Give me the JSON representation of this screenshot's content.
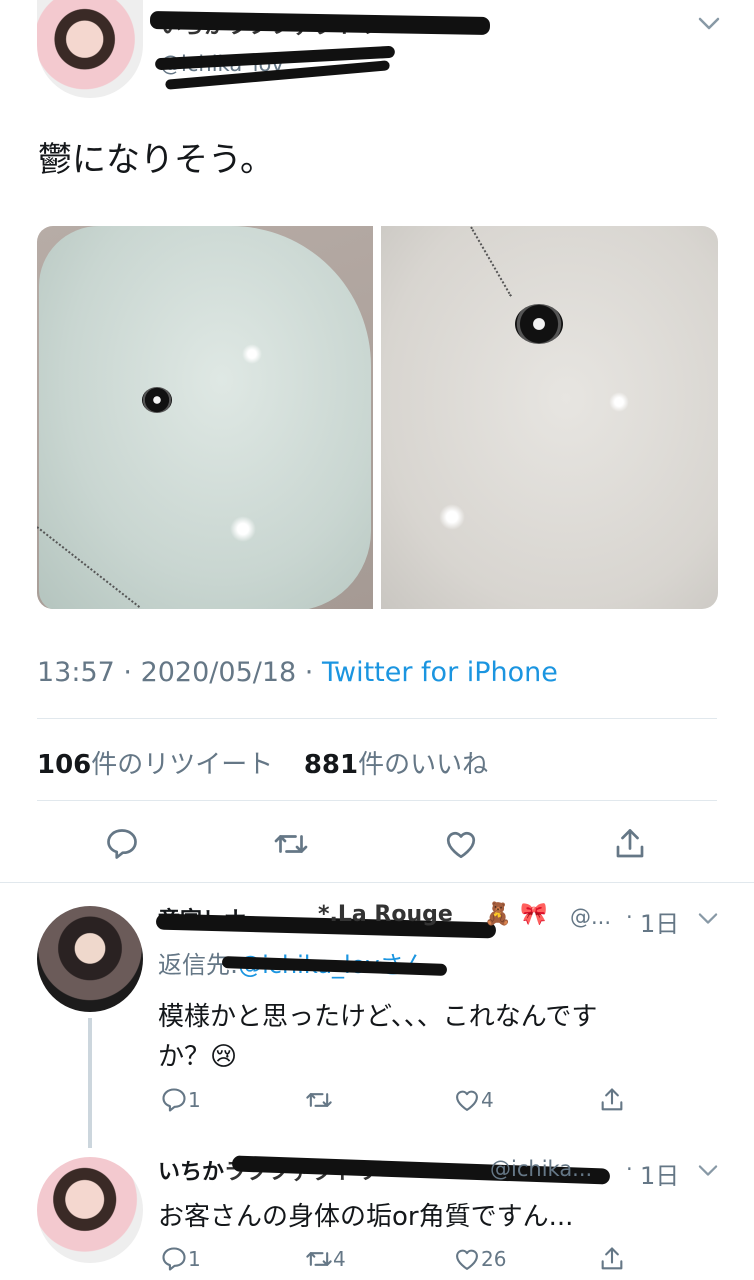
{
  "main_tweet": {
    "author_name": "いちかラブファクトリー",
    "author_handle": "@ichika_lov",
    "text": "鬱になりそう。",
    "time": "13:57",
    "date": "2020/05/18",
    "source": "Twitter for iPhone",
    "retweet_count": "106",
    "retweet_label": "件のリツイート",
    "like_count": "881",
    "like_label": "件のいいね"
  },
  "reply1": {
    "author_name": "竜宮レナ",
    "author_suffix": "*.La Rouge",
    "handle": "@...",
    "date": "1日",
    "reply_to_label": "返信先:",
    "reply_to_handle": "@ichika_lov",
    "reply_to_suffix": "さん",
    "text_line1": "模様かと思ったけど、、、これなんです",
    "text_line2": "か？",
    "reply_count": "1",
    "retweet_count": "",
    "like_count": "4"
  },
  "reply2": {
    "author_name": "いちか",
    "author_name_rest": "ラブファクトリー",
    "handle": "@ichika...",
    "date": "1日",
    "text": "お客さんの身体の垢or角質ですん...",
    "reply_count": "1",
    "retweet_count": "4",
    "like_count": "26"
  },
  "icons": {
    "caret": "chevron-down-icon",
    "reply": "reply-icon",
    "retweet": "retweet-icon",
    "like": "heart-icon",
    "share": "share-icon"
  },
  "colors": {
    "link": "#1b95e0",
    "muted": "#657786",
    "divider": "#e1e8ed"
  }
}
